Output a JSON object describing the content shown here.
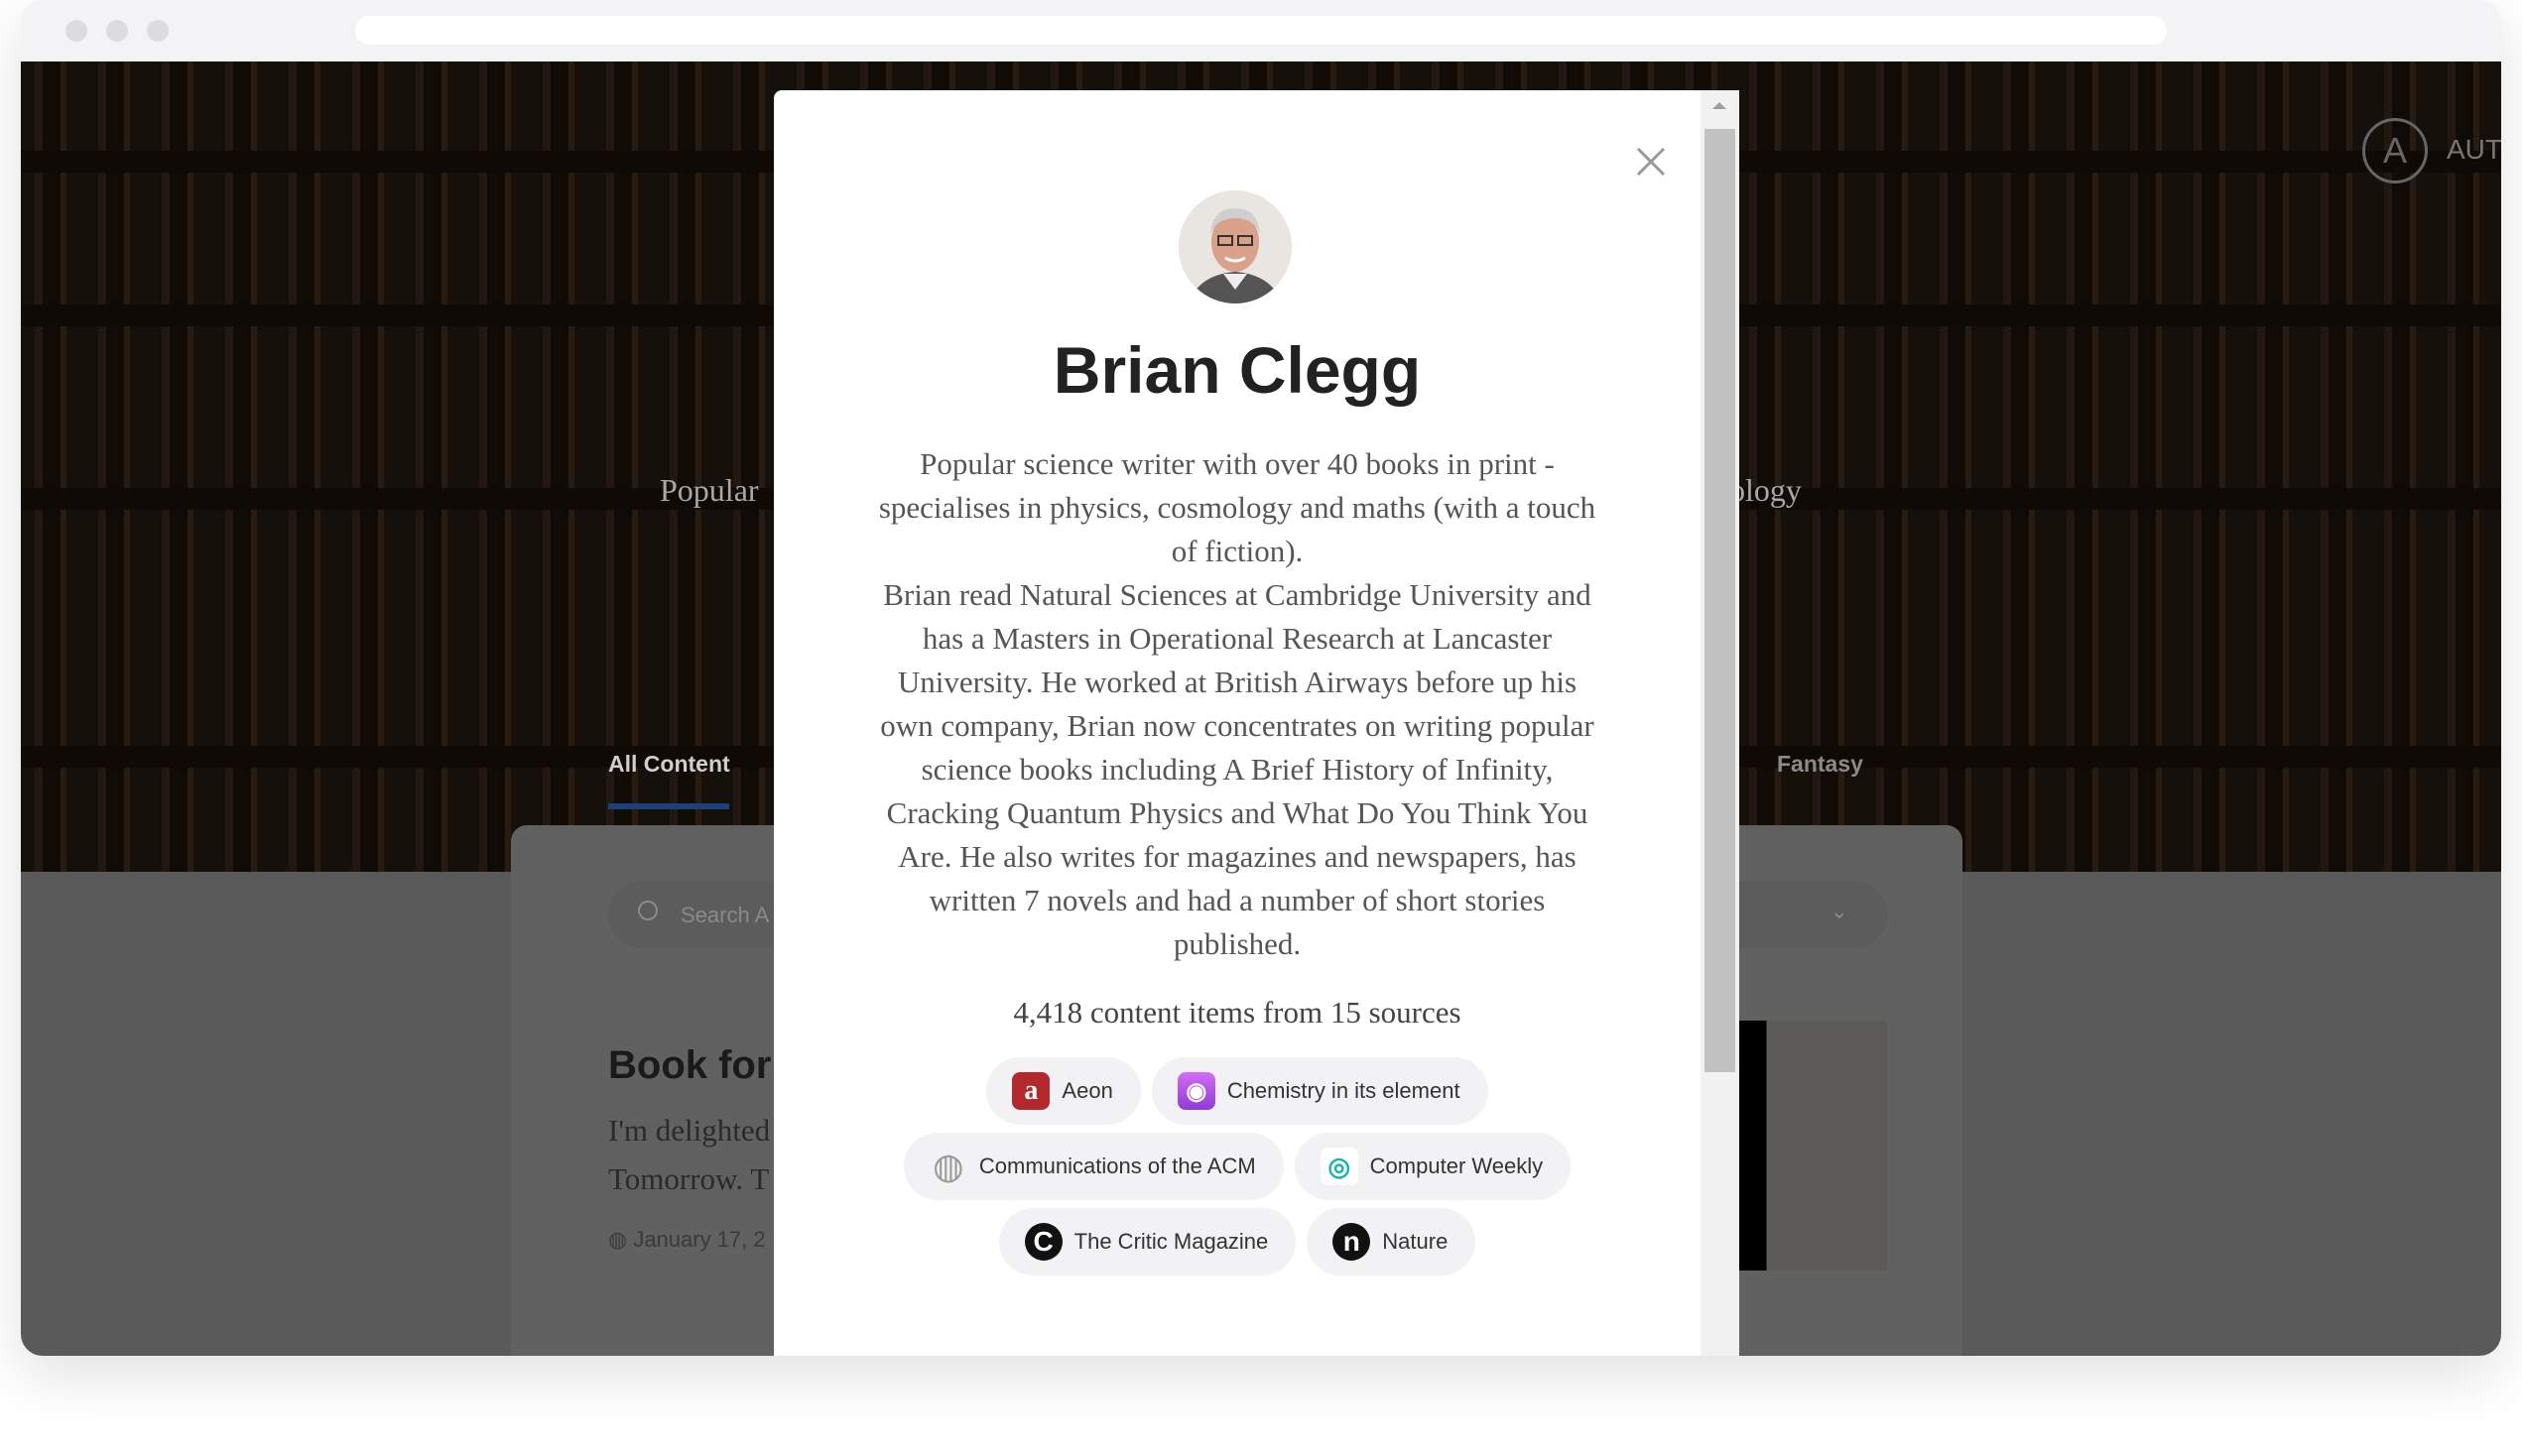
{
  "background": {
    "hero_left": "Popular",
    "hero_right": "ology",
    "tabs": [
      {
        "label": "All Content",
        "active": true
      },
      {
        "label": "Fantasy",
        "active": false
      }
    ],
    "logo_text": "AUT",
    "search_placeholder": "Search A",
    "post": {
      "title": "Book for",
      "excerpt_line1": "I'm delighted",
      "excerpt_line2": "Tomorrow. T",
      "date": "January 17, 2"
    },
    "accent": "#1d4fa8"
  },
  "modal": {
    "name": "Brian Clegg",
    "bio_lines": [
      "Popular science writer with over 40 books in print - specialises in physics, cosmology and maths (with a touch of fiction).",
      "Brian read Natural Sciences at Cambridge University and has a Masters in Operational Research at Lancaster University. He worked at British Airways before up his own company, Brian now concentrates on writing popular science books including A Brief History of Infinity, Cracking Quantum Physics and What Do You Think You Are. He also writes for magazines and newspapers, has written 7 novels and had a number of short stories published."
    ],
    "count": "4,418 content items from 15 sources",
    "sources": [
      {
        "label": "Aeon",
        "icon": "aeon-logo-icon",
        "color": "#b3282d"
      },
      {
        "label": "Chemistry in its element",
        "icon": "podcast-icon",
        "color": "#b150e2"
      },
      {
        "label": "Communications of the ACM",
        "icon": "globe-icon",
        "color": "#999999"
      },
      {
        "label": "Computer Weekly",
        "icon": "eye-logo-icon",
        "color": "#19b3b3"
      },
      {
        "label": "The Critic Magazine",
        "icon": "critic-logo-icon",
        "color": "#111111"
      },
      {
        "label": "Nature",
        "icon": "nature-logo-icon",
        "color": "#111111"
      }
    ]
  }
}
